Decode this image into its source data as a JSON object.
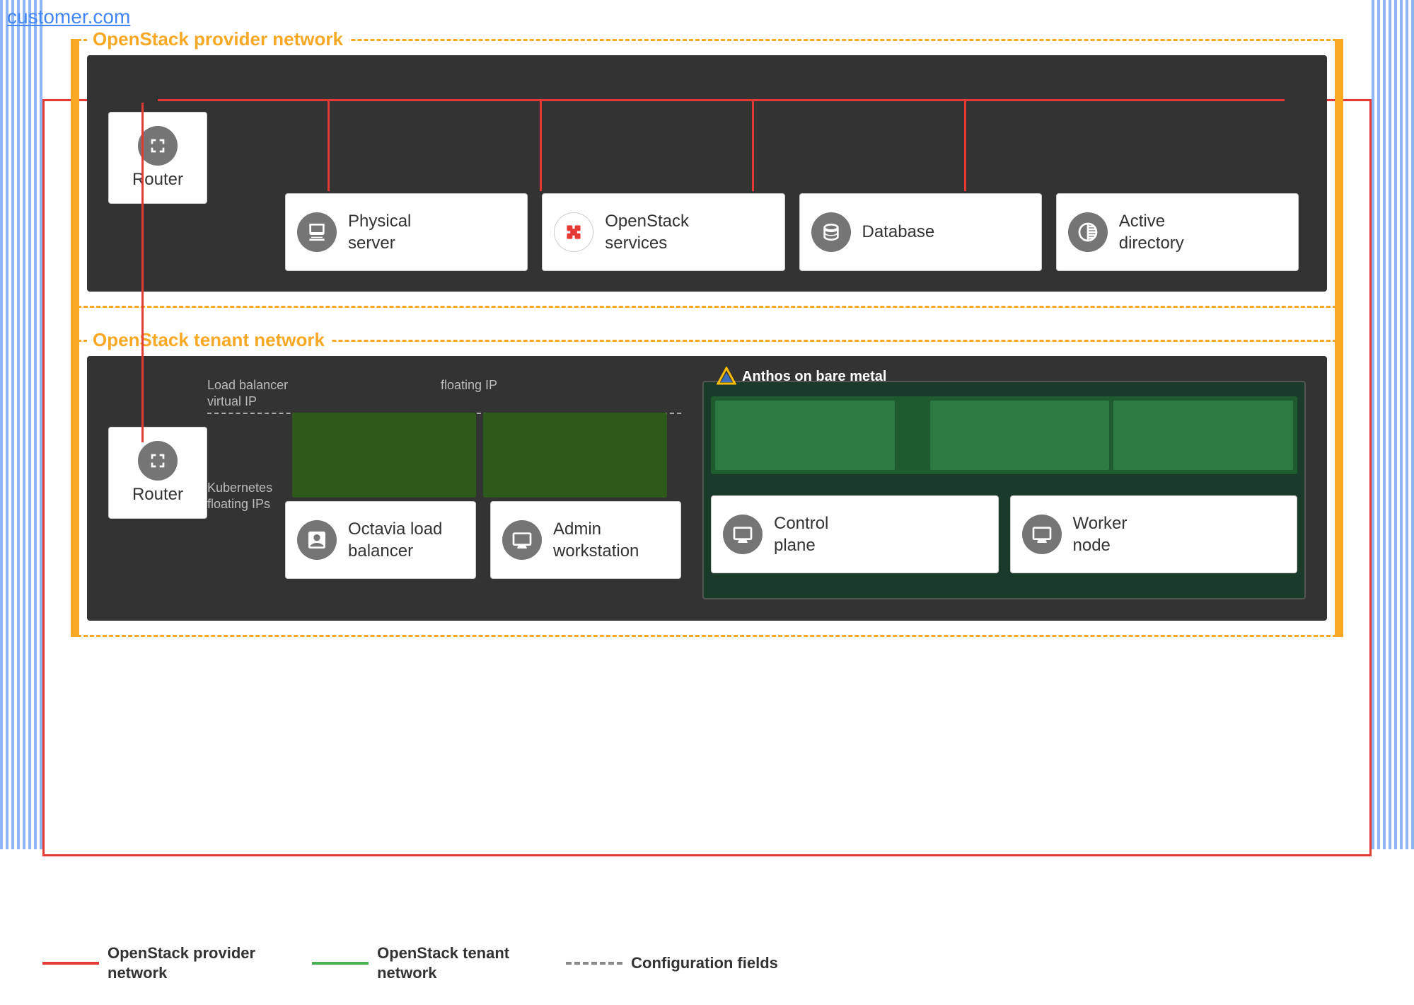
{
  "site": {
    "domain": "customer.com"
  },
  "provider_network": {
    "label": "OpenStack provider network",
    "router_label": "Router",
    "services": [
      {
        "id": "physical-server",
        "name": "Physical server",
        "icon": "server"
      },
      {
        "id": "openstack-services",
        "name": "OpenStack services",
        "icon": "openstack"
      },
      {
        "id": "database",
        "name": "Database",
        "icon": "database"
      },
      {
        "id": "active-directory",
        "name": "Active directory",
        "icon": "directory"
      }
    ]
  },
  "tenant_network": {
    "label": "OpenStack tenant network",
    "router_label": "Router",
    "floating_labels": {
      "load_balancer_vip": "Load balancer\nvirtual IP",
      "floating_ip": "floating IP",
      "kubernetes_floating": "Kubernetes\nfloating IPs"
    },
    "services": [
      {
        "id": "octavia-lb",
        "name": "Octavia load\nbalancer",
        "icon": "loadbalancer"
      },
      {
        "id": "admin-workstation",
        "name": "Admin\nworkstation",
        "icon": "compute"
      }
    ],
    "anthos": {
      "label": "Anthos on bare metal",
      "services": [
        {
          "id": "control-plane",
          "name": "Control\nplane",
          "icon": "compute"
        },
        {
          "id": "worker-node",
          "name": "Worker\nnode",
          "icon": "compute"
        }
      ]
    }
  },
  "legend": {
    "items": [
      {
        "id": "provider-legend",
        "color": "#e53935",
        "label": "OpenStack provider\nnetwork"
      },
      {
        "id": "tenant-legend",
        "color": "#4caf50",
        "label": "OpenStack tenant\nnetwork"
      },
      {
        "id": "config-legend",
        "type": "dashed",
        "label": "Configuration fields"
      }
    ]
  }
}
